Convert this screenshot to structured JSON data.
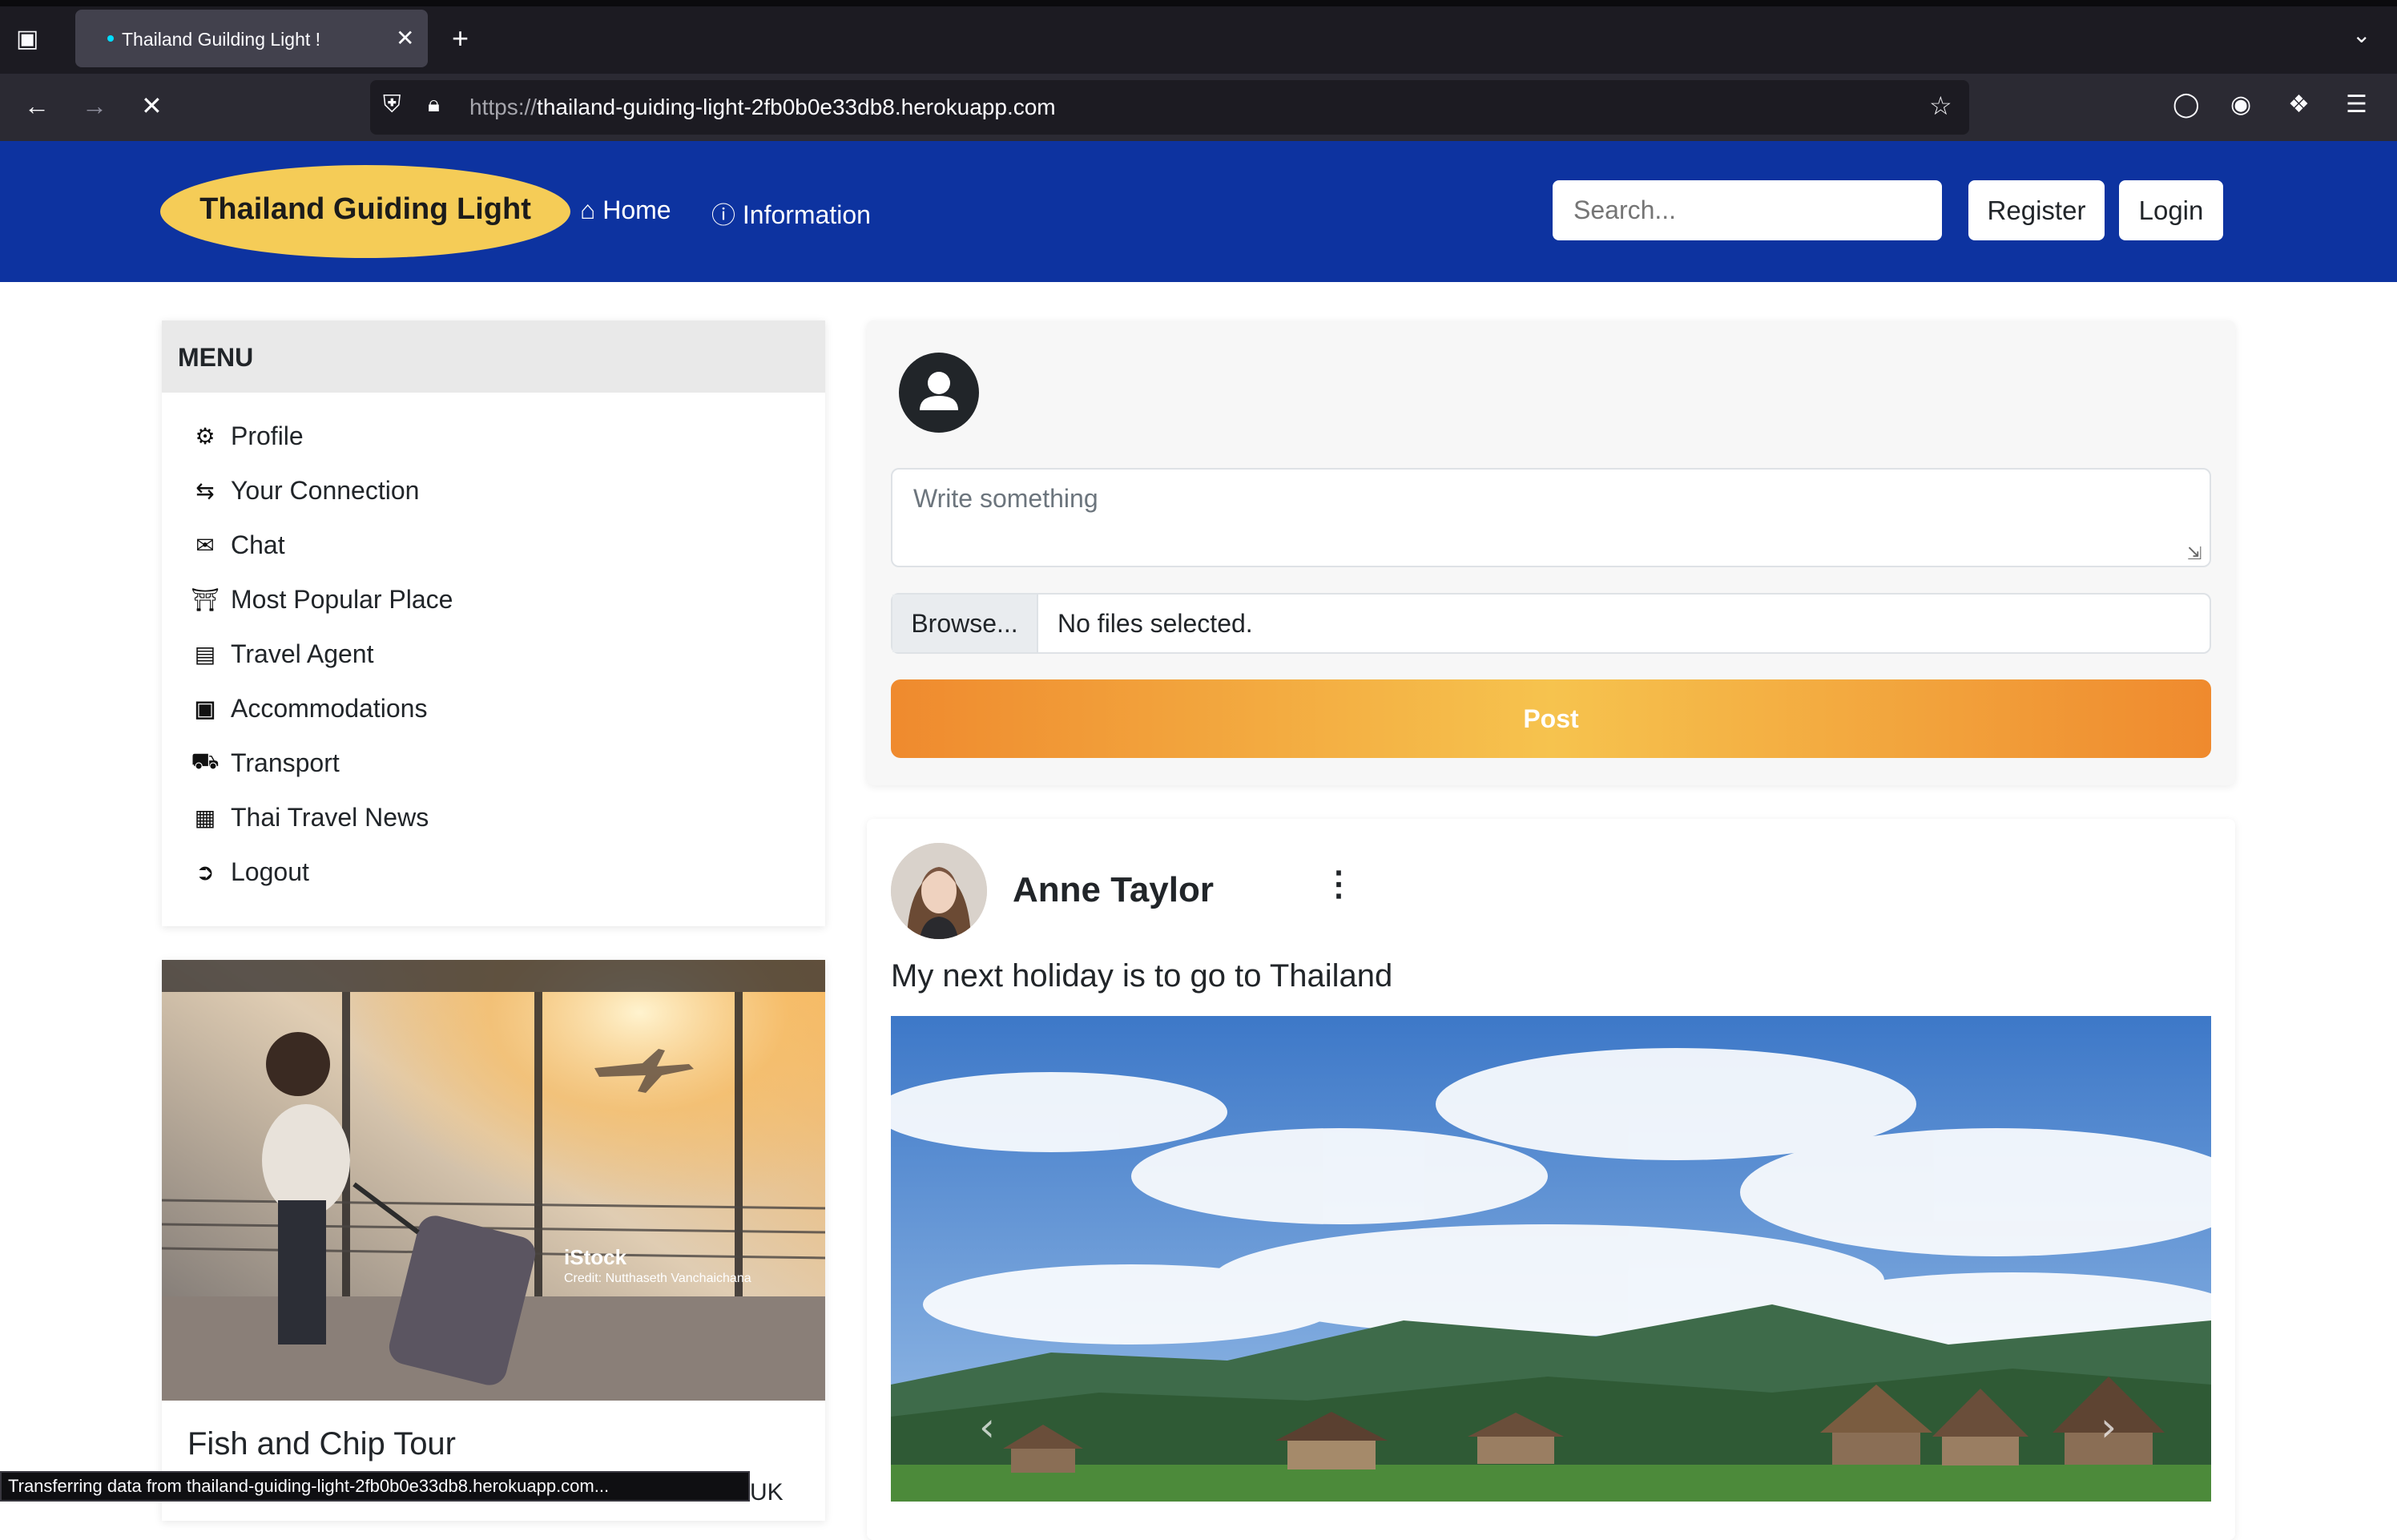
{
  "browser": {
    "tab_title": "Thailand Guilding Light !",
    "url_protocol": "https://",
    "url_host": "thailand-guiding-light-2fb0b0e33db8.herokuapp.com",
    "status_text": "Transferring data from thailand-guiding-light-2fb0b0e33db8.herokuapp.com..."
  },
  "header": {
    "brand": "Thailand Guiding Light",
    "nav": [
      {
        "label": "Home",
        "icon": "home-icon"
      },
      {
        "label": "Information",
        "icon": "info-circle-icon"
      }
    ],
    "search_placeholder": "Search...",
    "register_label": "Register",
    "login_label": "Login",
    "brand_color": "#0d33a0",
    "logo_color": "#f5cc57"
  },
  "menu": {
    "title": "MENU",
    "items": [
      {
        "label": "Profile",
        "icon": "gear-icon"
      },
      {
        "label": "Your Connection",
        "icon": "people-arrows-icon"
      },
      {
        "label": "Chat",
        "icon": "comments-icon"
      },
      {
        "label": "Most Popular Place",
        "icon": "landmark-icon"
      },
      {
        "label": "Travel Agent",
        "icon": "luggage-cart-icon"
      },
      {
        "label": "Accommodations",
        "icon": "hotel-h-icon"
      },
      {
        "label": "Transport",
        "icon": "taxi-icon"
      },
      {
        "label": "Thai Travel News",
        "icon": "newspaper-icon"
      },
      {
        "label": "Logout",
        "icon": "sign-out-icon"
      }
    ]
  },
  "tour_card": {
    "image_watermark": "iStock",
    "image_credit": "Credit: Nutthaseth Vanchaichana",
    "title": "Fish and Chip Tour",
    "snippet_cut": "UK"
  },
  "composer": {
    "textarea_placeholder": "Write something",
    "browse_label": "Browse...",
    "file_status": "No files selected.",
    "post_label": "Post"
  },
  "feed_post": {
    "author": "Anne Taylor",
    "text": "My next holiday is to go to Thailand"
  }
}
